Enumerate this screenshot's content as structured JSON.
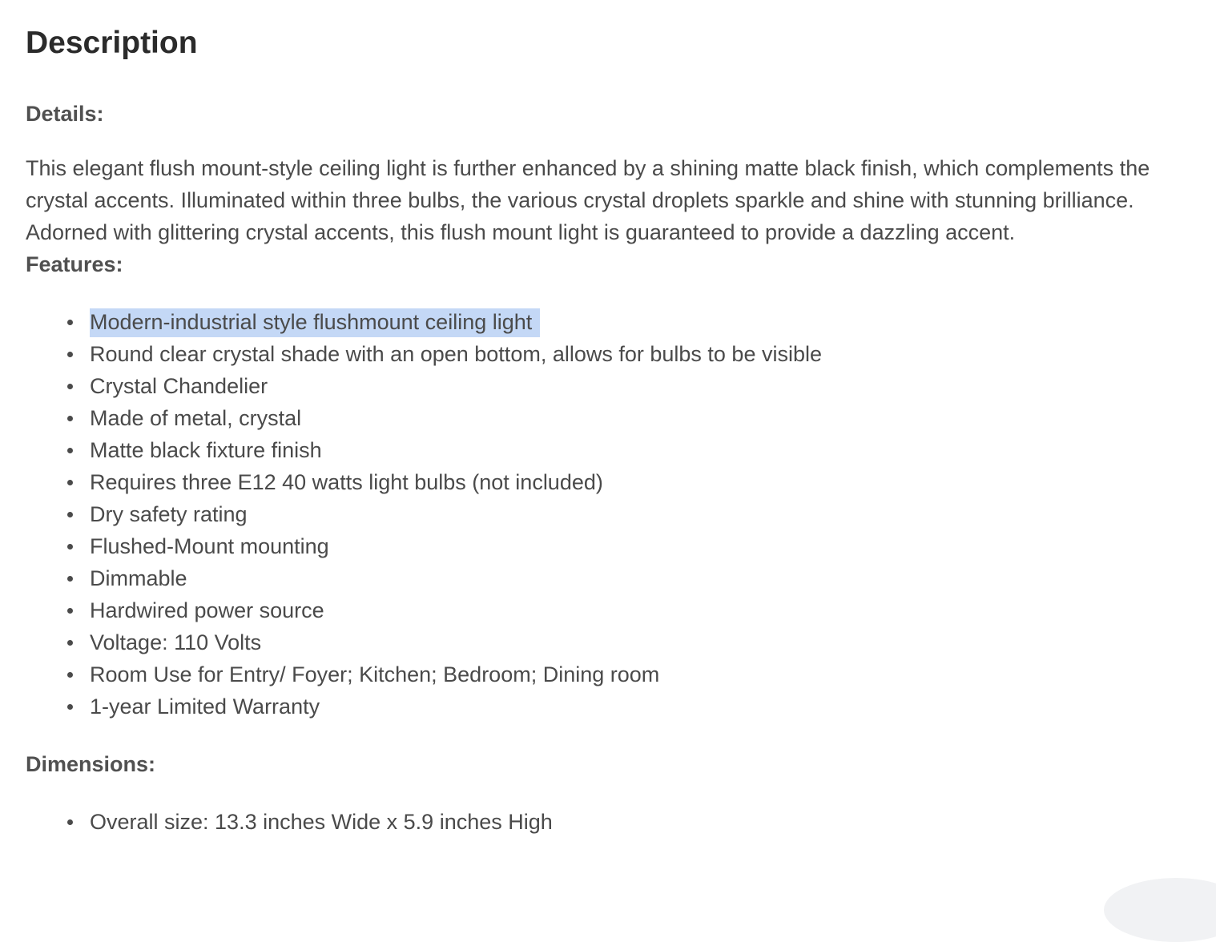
{
  "title": "Description",
  "details": {
    "label": "Details:",
    "text": "This elegant flush mount-style ceiling light is further enhanced by a shining matte black finish, which complements the crystal accents. Illuminated within three bulbs, the various crystal droplets sparkle and shine with stunning brilliance. Adorned with glittering crystal accents, this flush mount light is guaranteed to provide a dazzling accent."
  },
  "features": {
    "label": "Features:",
    "items": [
      "Modern-industrial style flushmount ceiling light",
      "Round clear crystal shade with an open bottom, allows for bulbs to be visible",
      "Crystal Chandelier",
      "Made of metal, crystal",
      "Matte black fixture finish",
      "Requires three E12 40 watts light bulbs (not included)",
      "Dry safety rating",
      "Flushed-Mount mounting",
      "Dimmable",
      "Hardwired power source",
      "Voltage: 110 Volts",
      "Room Use for Entry/ Foyer; Kitchen; Bedroom; Dining room",
      "1-year Limited Warranty"
    ]
  },
  "dimensions": {
    "label": "Dimensions:",
    "items": [
      "Overall size: 13.3 inches Wide x 5.9 inches High"
    ]
  },
  "colors": {
    "selection_highlight": "#c4d8f6",
    "heading": "#2b2b2b",
    "body_text": "#4a4a4a"
  }
}
